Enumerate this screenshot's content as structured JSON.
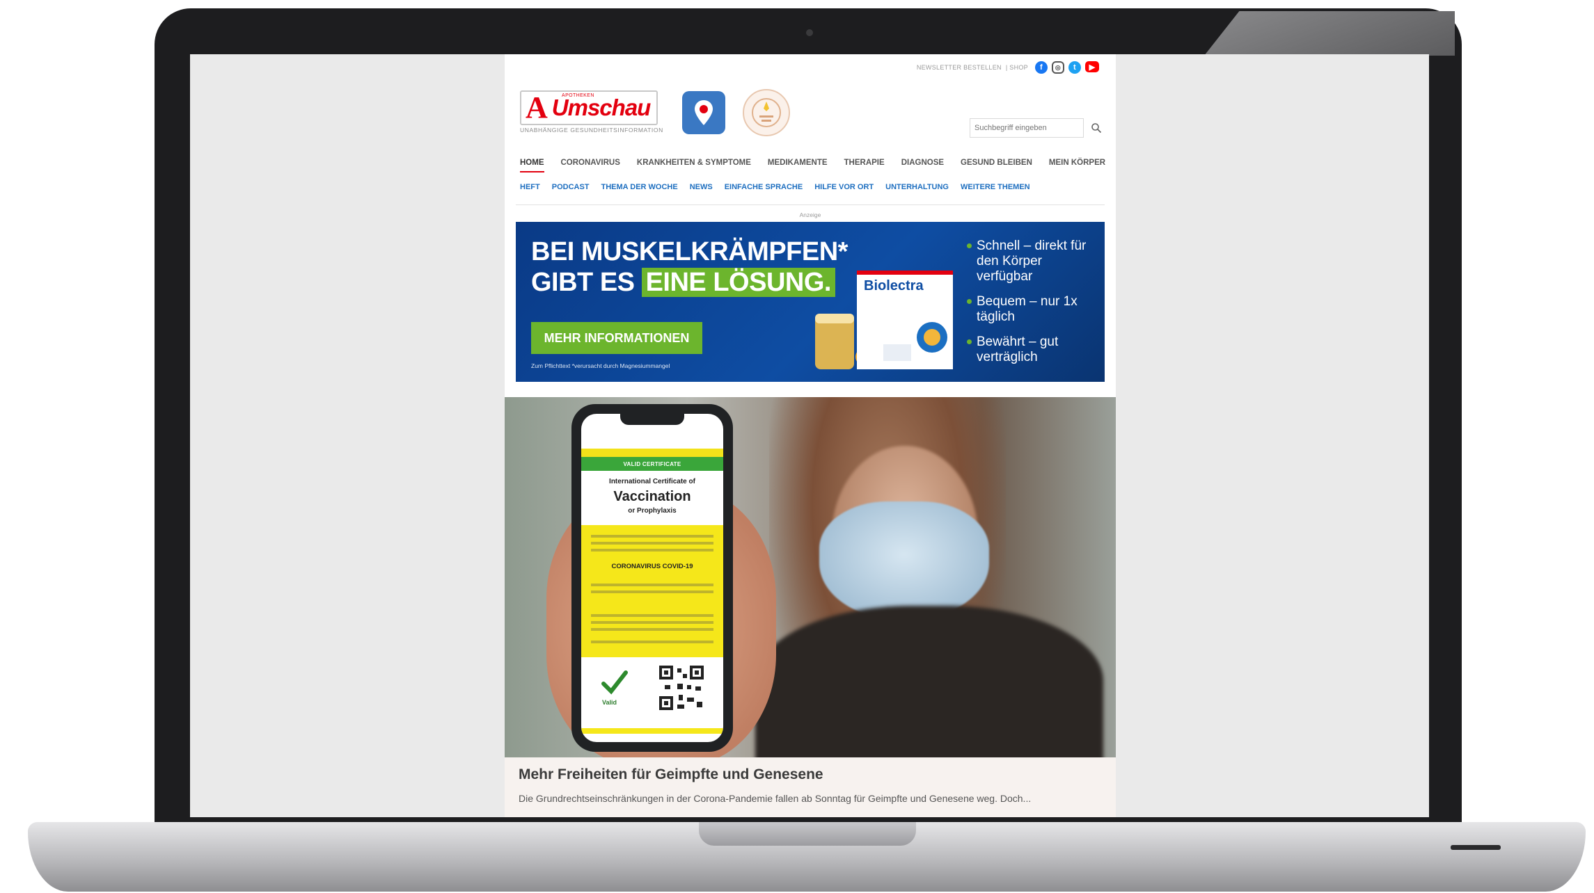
{
  "header": {
    "top_links": "NEWSLETTER BESTELLEN",
    "shop": "| SHOP",
    "social": [
      "facebook-icon",
      "instagram-icon",
      "twitter-icon",
      "youtube-icon"
    ],
    "logo_kicker": "APOTHEKEN",
    "logo_a": "A",
    "logo_word": "Umschau",
    "logo_sub": "UNABHÄNGIGE GESUNDHEITSINFORMATION",
    "search_placeholder": "Suchbegriff eingeben"
  },
  "main_nav": [
    "HOME",
    "CORONAVIRUS",
    "KRANKHEITEN & SYMPTOME",
    "MEDIKAMENTE",
    "THERAPIE",
    "DIAGNOSE",
    "GESUND BLEIBEN",
    "MEIN KÖRPER"
  ],
  "sub_nav": [
    "HEFT",
    "PODCAST",
    "THEMA DER WOCHE",
    "NEWS",
    "EINFACHE SPRACHE",
    "HILFE VOR ORT",
    "UNTERHALTUNG",
    "WEITERE THEMEN"
  ],
  "ad": {
    "label": "Anzeige",
    "headline_line1": "BEI MUSKELKRÄMPFEN*",
    "headline_line2_prefix": "GIBT ES ",
    "headline_line2_highlight": "EINE LÖSUNG.",
    "button": "MEHR INFORMATIONEN",
    "fine_print": "Zum Pflichttext   *verursacht durch Magnesiummangel",
    "product_name": "Biolectra",
    "bullets": [
      "Schnell – direkt für den Körper verfügbar",
      "Bequem – nur 1x täglich",
      "Bewährt – gut verträglich"
    ],
    "colors": {
      "background": "#0e4da3",
      "accent": "#6cb52d"
    }
  },
  "hero": {
    "phone_header": "VALID CERTIFICATE",
    "phone_line1": "International Certificate of",
    "phone_line2": "Vaccination",
    "phone_line3": "or Prophylaxis",
    "phone_covid": "CORONAVIRUS COVID-19",
    "phone_valid": "Valid"
  },
  "article": {
    "headline": "Mehr Freiheiten für Geimpfte und Genesene",
    "teaser": "Die Grundrechtseinschränkungen in der Corona-Pandemie fallen ab Sonntag für Geimpfte und Genesene weg. Doch..."
  },
  "colors": {
    "brand_red": "#e3000f",
    "link_blue": "#1e6fc0"
  }
}
